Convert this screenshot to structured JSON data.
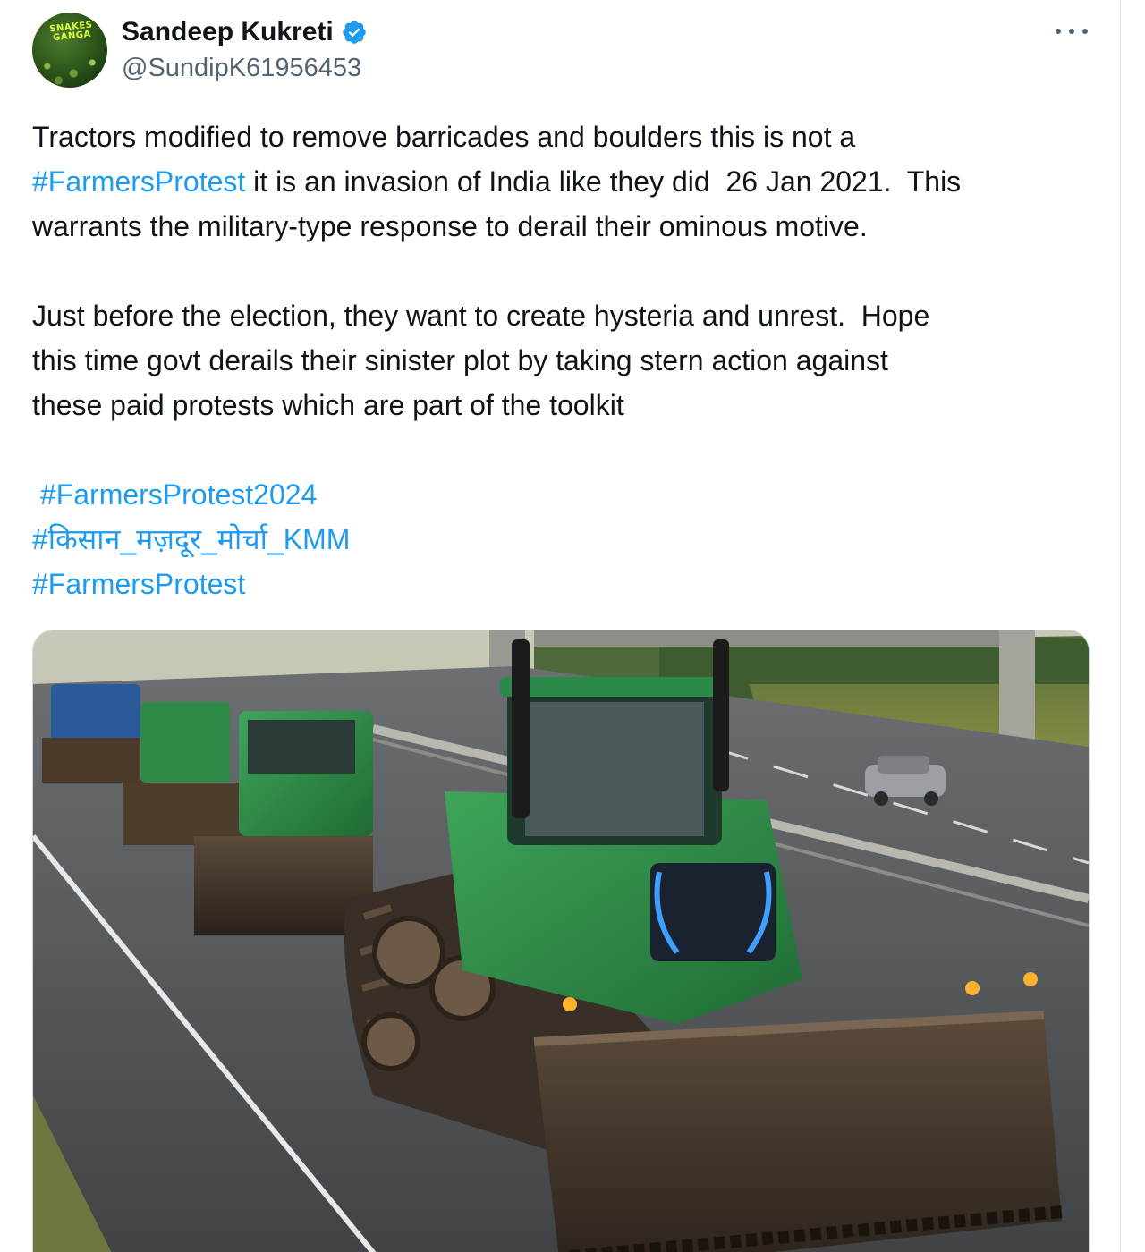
{
  "author": {
    "display_name": "Sandeep Kukreti",
    "handle": "@SundipK61956453",
    "verified": true,
    "avatar_text": "SNAKES GANGA"
  },
  "menu": {
    "more_icon": "more-horizontal-icon"
  },
  "tweet": {
    "line1": "Tractors modified to remove barricades and boulders this is not a",
    "line2_tag": "#FarmersProtest",
    "line2_rest": " it is an invasion of India like they did  26 Jan 2021.  This",
    "line3": "warrants the military-type response to derail their ominous motive.",
    "line4": "Just before the election, they want to create hysteria and unrest.  Hope",
    "line5": "this time govt derails their sinister plot by taking stern action against",
    "line6": "these paid protests which are part of the toolkit",
    "hashtags": [
      " #FarmersProtest2024",
      "#किसान_मज़दूर_मोर्चा_KMM",
      "#FarmersProtest"
    ]
  },
  "colors": {
    "text": "#0f1419",
    "secondary": "#536471",
    "link": "#1d9bf0",
    "verified": "#1d9bf0"
  },
  "media": {
    "type": "image",
    "icon": "photo-icon"
  }
}
